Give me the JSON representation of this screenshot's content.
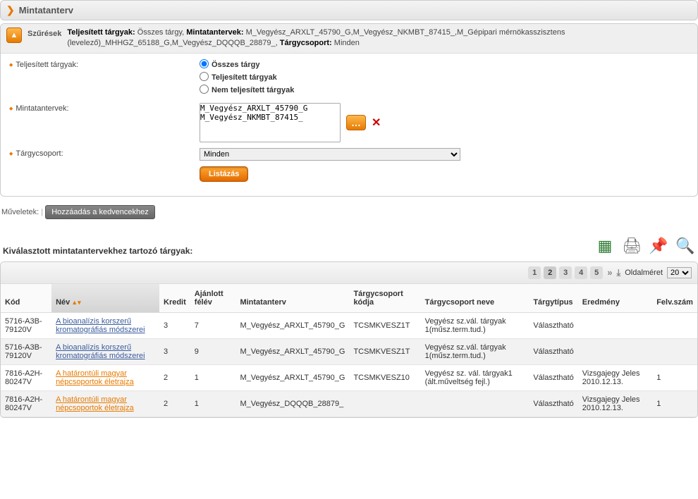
{
  "header": {
    "title": "Mintatanterv"
  },
  "filter": {
    "label": "Szűrések",
    "summary_html": "<b>Teljesített tárgyak:</b> Összes tárgy, <b>Mintatantervek:</b> M_Vegyész_ARXLT_45790_G,M_Vegyész_NKMBT_87415_,M_Gépipari mérnökasszisztens (levelező)_MHHGZ_65188_G,M_Vegyész_DQQQB_28879_, <b>Tárgycsoport:</b> Minden",
    "completed_label": "Teljesített tárgyak:",
    "radios": {
      "all": "Összes tárgy",
      "done": "Teljesített tárgyak",
      "notdone": "Nem teljesített tárgyak",
      "selected": "all"
    },
    "plans_label": "Mintatantervek:",
    "plan_options": [
      "M_Vegyész_ARXLT_45790_G",
      "M_Vegyész_NKMBT_87415_"
    ],
    "group_label": "Tárgycsoport:",
    "group_value": "Minden",
    "list_btn": "Listázás"
  },
  "ops": {
    "label": "Műveletek:",
    "fav_btn": "Hozzáadás a kedvencekhez"
  },
  "section": {
    "title": "Kiválasztott mintatantervekhez tartozó tárgyak:"
  },
  "pager": {
    "pages": [
      "1",
      "2",
      "3",
      "4",
      "5"
    ],
    "active": 1,
    "size_label": "Oldalméret",
    "size_value": "20"
  },
  "columns": {
    "code": "Kód",
    "name": "Név",
    "credit": "Kredit",
    "sem": "Ajánlott félév",
    "plan": "Mintatanterv",
    "grpcode": "Tárgycsoport kódja",
    "grpname": "Tárgycsoport neve",
    "type": "Tárgytípus",
    "result": "Eredmény",
    "felv": "Felv.szám"
  },
  "rows": [
    {
      "odd": true,
      "code": "5716-A3B-79120V",
      "name": "A bioanalízis korszerű kromatográfiás módszerei",
      "name_link": "blue",
      "credit": "3",
      "sem": "7",
      "plan": "M_Vegyész_ARXLT_45790_G",
      "gcode": "TCSMKVESZ1T",
      "gname": "Vegyész sz.vál. tárgyak 1(műsz.term.tud.)",
      "type": "Választható",
      "result": "",
      "felv": ""
    },
    {
      "odd": false,
      "code": "5716-A3B-79120V",
      "name": "A bioanalízis korszerű kromatográfiás módszerei",
      "name_link": "blue",
      "credit": "3",
      "sem": "9",
      "plan": "M_Vegyész_ARXLT_45790_G",
      "gcode": "TCSMKVESZ1T",
      "gname": "Vegyész sz.vál. tárgyak 1(műsz.term.tud.)",
      "type": "Választható",
      "result": "",
      "felv": ""
    },
    {
      "odd": true,
      "code": "7816-A2H-80247V",
      "name": "A határontúli magyar népcsoportok életrajza",
      "name_link": "orange",
      "credit": "2",
      "sem": "1",
      "plan": "M_Vegyész_ARXLT_45790_G",
      "gcode": "TCSMKVESZ10",
      "gname": "Vegyész sz. vál. tárgyak1 (ált.műveltség fejl.)",
      "type": "Választható",
      "result": "Vizsgajegy Jeles 2010.12.13.",
      "felv": "1"
    },
    {
      "odd": false,
      "code": "7816-A2H-80247V",
      "name": "A határontúli magyar népcsoportok életrajza",
      "name_link": "orange",
      "credit": "2",
      "sem": "1",
      "plan": "M_Vegyész_DQQQB_28879_",
      "gcode": "",
      "gname": "",
      "type": "Választható",
      "result": "Vizsgajegy Jeles 2010.12.13.",
      "felv": "1"
    }
  ]
}
